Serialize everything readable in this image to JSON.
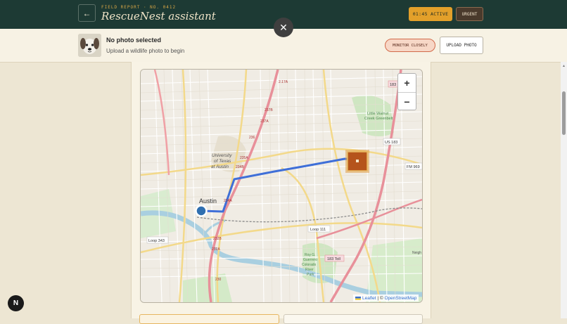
{
  "header": {
    "eyebrow": "FIELD REPORT · NO. 0412",
    "title": "RescueNest assistant",
    "back_icon": "arrow-left-icon",
    "timer_badge": "01:45 ACTIVE",
    "urgent_label": "URGENT"
  },
  "photo": {
    "title": "No photo selected",
    "subtitle": "Upload a wildlife photo to begin",
    "thumbnail_icon": "dog-face-icon",
    "status_pill": "MONITOR CLOSELY",
    "upload_label": "UPLOAD PHOTO"
  },
  "overlay": {
    "close_icon": "close-icon"
  },
  "map": {
    "zoom_in": "+",
    "zoom_out": "−",
    "attribution_link1": "Leaflet",
    "attribution_sep": " | © ",
    "attribution_link2": "OpenStreetMap",
    "labels": {
      "city": "Austin",
      "university_1": "University",
      "university_2": "of Texas",
      "university_3": "at Austin",
      "park_1": "Little Walnut",
      "park_2": "Creek Greenbelt",
      "us183": "US 183",
      "fm969": "FM 969",
      "loop111": "Loop 111",
      "toll183": "183 Toll",
      "loop343": "Loop 343",
      "shield183": "183",
      "park2_1": "Roy G.",
      "park2_2": "Guerrero",
      "park2_3": "Colorado",
      "park2_4": "River",
      "park2_5": "Park",
      "neigh": "Neigh",
      "r1": "2.17A",
      "r2": "237B",
      "r3": "237A",
      "r4": "236",
      "r5": "235A",
      "r6": "234B",
      "r7": "234A",
      "r8": "232B",
      "r9": "232A",
      "r10": "230"
    },
    "colors": {
      "route": "#3f6fd8",
      "origin_marker": "#2f6fb0",
      "destination_marker": "#b5541c"
    }
  },
  "fab": {
    "label": "N"
  }
}
